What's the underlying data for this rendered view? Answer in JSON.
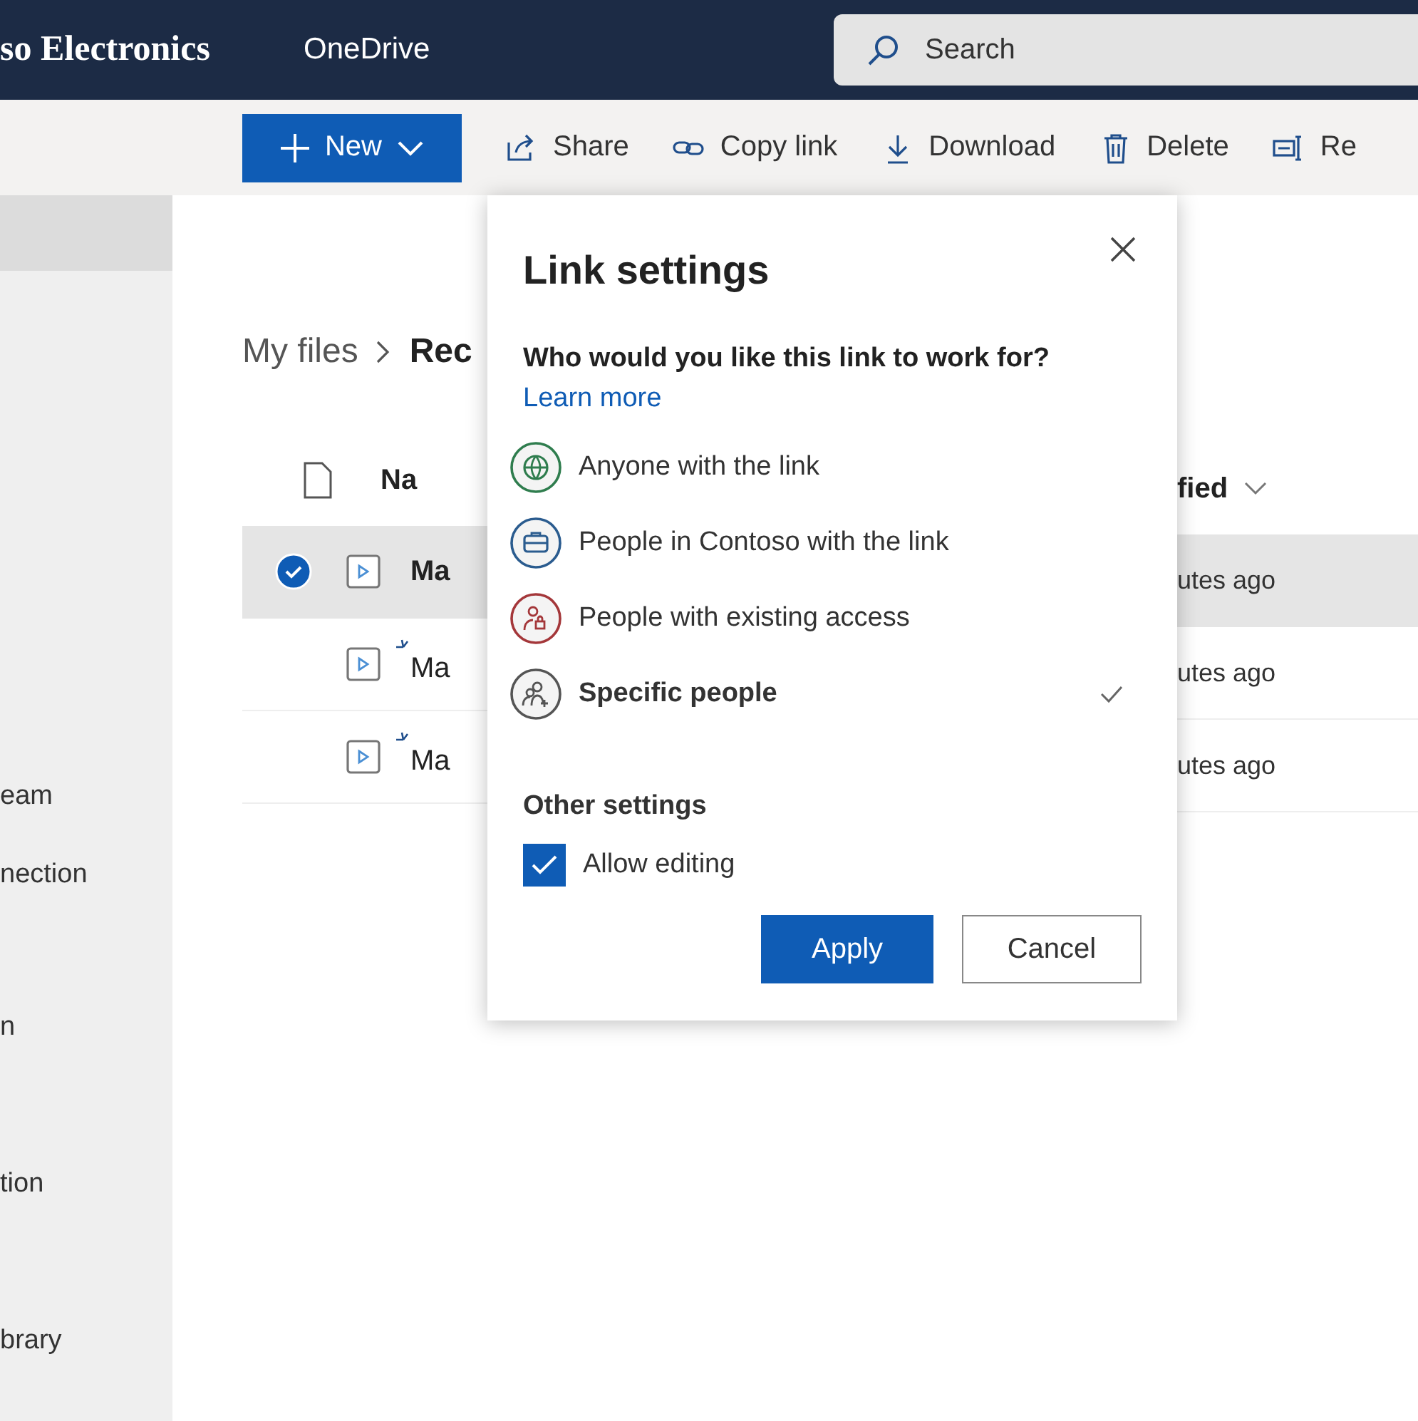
{
  "header": {
    "org": "so Electronics",
    "app": "OneDrive",
    "search": {
      "placeholder": "Search"
    }
  },
  "toolbar": {
    "new_button": "New",
    "actions": [
      {
        "kind": "share",
        "label": "Share"
      },
      {
        "kind": "link",
        "label": "Copy link"
      },
      {
        "kind": "download",
        "label": "Download"
      },
      {
        "kind": "delete",
        "label": "Delete"
      },
      {
        "kind": "rename",
        "label": "Re"
      }
    ]
  },
  "sidebar": {
    "items": [
      {
        "selected": true
      },
      {
        "label": "eam",
        "selected": false
      },
      {
        "label": "nection",
        "selected": false
      },
      {
        "label": "n",
        "selected": false
      },
      {
        "label": "tion",
        "selected": false
      },
      {
        "label": "brary",
        "selected": false
      }
    ]
  },
  "breadcrumb": [
    "My files",
    "Rec"
  ],
  "table": {
    "columns": [
      "Na",
      "fied"
    ],
    "rows": [
      {
        "name": "Ma",
        "modified": "utes ago",
        "selected": true,
        "new": false
      },
      {
        "name": "Ma",
        "modified": "utes ago",
        "selected": false,
        "new": true
      },
      {
        "name": "Ma",
        "modified": "utes ago",
        "selected": false,
        "new": true
      }
    ]
  },
  "dialog": {
    "title": "Link settings",
    "question": "Who would you like this link to work for?",
    "learn_more": "Learn more",
    "options": [
      {
        "kind": "anyone",
        "label": "Anyone with the link",
        "color": "#2f7d4e",
        "selected": false
      },
      {
        "kind": "org",
        "label": "People in Contoso with the link",
        "color": "#2b5c8f",
        "selected": false
      },
      {
        "kind": "existing",
        "label": "People with existing access",
        "color": "#a4373a",
        "selected": false
      },
      {
        "kind": "specific",
        "label": "Specific people",
        "color": "#555555",
        "selected": true
      }
    ],
    "other_settings": "Other settings",
    "allow_editing": {
      "label": "Allow editing",
      "checked": true
    },
    "buttons": {
      "apply": "Apply",
      "cancel": "Cancel"
    }
  }
}
